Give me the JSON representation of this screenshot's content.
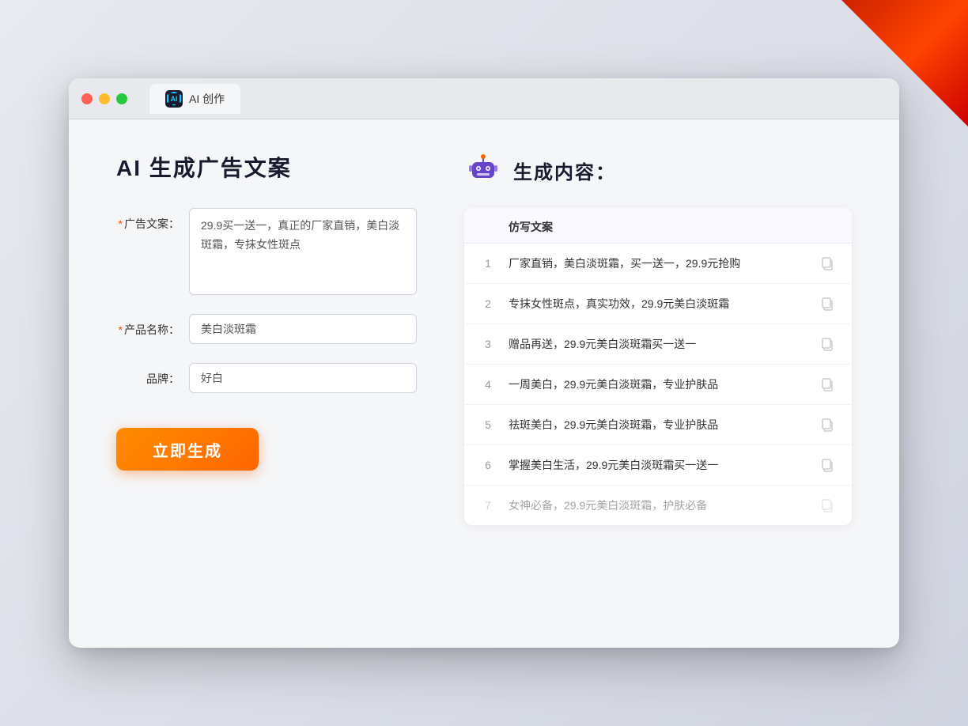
{
  "window": {
    "tab_label": "AI 创作",
    "traffic_lights": [
      "red",
      "yellow",
      "green"
    ]
  },
  "left_panel": {
    "page_title": "AI 生成广告文案",
    "form": {
      "ad_copy_label": "广告文案：",
      "ad_copy_required": "*",
      "ad_copy_value": "29.9买一送一，真正的厂家直销，美白淡斑霜，专抹女性斑点",
      "product_name_label": "产品名称：",
      "product_name_required": "*",
      "product_name_value": "美白淡斑霜",
      "brand_label": "品牌：",
      "brand_value": "好白"
    },
    "generate_btn": "立即生成"
  },
  "right_panel": {
    "title": "生成内容：",
    "column_header": "仿写文案",
    "results": [
      {
        "num": "1",
        "text": "厂家直销，美白淡斑霜，买一送一，29.9元抢购",
        "faded": false
      },
      {
        "num": "2",
        "text": "专抹女性斑点，真实功效，29.9元美白淡斑霜",
        "faded": false
      },
      {
        "num": "3",
        "text": "赠品再送，29.9元美白淡斑霜买一送一",
        "faded": false
      },
      {
        "num": "4",
        "text": "一周美白，29.9元美白淡斑霜，专业护肤品",
        "faded": false
      },
      {
        "num": "5",
        "text": "祛斑美白，29.9元美白淡斑霜，专业护肤品",
        "faded": false
      },
      {
        "num": "6",
        "text": "掌握美白生活，29.9元美白淡斑霜买一送一",
        "faded": false
      },
      {
        "num": "7",
        "text": "女神必备，29.9元美白淡斑霜，护肤必备",
        "faded": true
      }
    ]
  }
}
